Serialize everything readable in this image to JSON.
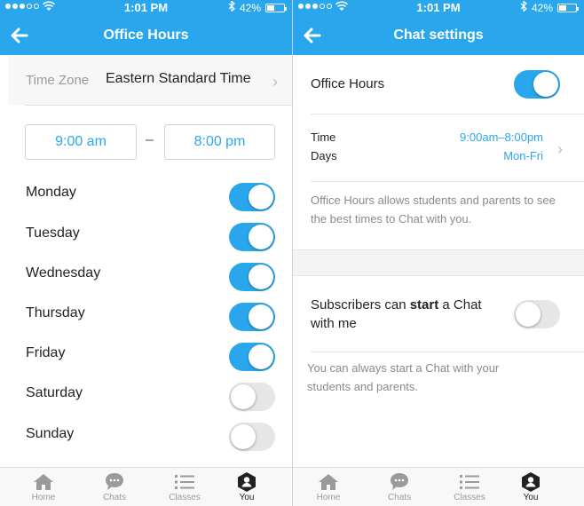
{
  "status_bar": {
    "time": "1:01 PM",
    "battery": "42%",
    "signal_bars": 3,
    "battery_level": 0.42
  },
  "left": {
    "title": "Office Hours",
    "time_zone_label": "Time Zone",
    "time_zone_value": "Eastern Standard Time",
    "start_time": "9:00 am",
    "end_time": "8:00 pm",
    "dash": "–",
    "days": [
      {
        "label": "Monday",
        "on": true
      },
      {
        "label": "Tuesday",
        "on": true
      },
      {
        "label": "Wednesday",
        "on": true
      },
      {
        "label": "Thursday",
        "on": true
      },
      {
        "label": "Friday",
        "on": true
      },
      {
        "label": "Saturday",
        "on": false
      },
      {
        "label": "Sunday",
        "on": false
      }
    ]
  },
  "right": {
    "title": "Chat settings",
    "office_hours_label": "Office Hours",
    "office_hours_on": true,
    "time_label": "Time",
    "days_label": "Days",
    "time_value": "9:00am–8:00pm",
    "days_value": "Mon-Fri",
    "office_hours_desc": "Office Hours allows students and parents to see the best times to Chat with you.",
    "subscribers_pre": "Subscribers can ",
    "subscribers_bold": "start",
    "subscribers_post": " a Chat with me",
    "subscribers_on": false,
    "subscribers_desc": "You can always start a Chat with your students and parents."
  },
  "tabs": [
    {
      "label": "Home",
      "icon": "home-icon"
    },
    {
      "label": "Chats",
      "icon": "chats-icon"
    },
    {
      "label": "Classes",
      "icon": "classes-icon"
    },
    {
      "label": "You",
      "icon": "you-icon",
      "active": true
    }
  ],
  "colors": {
    "accent": "#2aa7ec",
    "toggle_off": "#e6e6e6"
  }
}
